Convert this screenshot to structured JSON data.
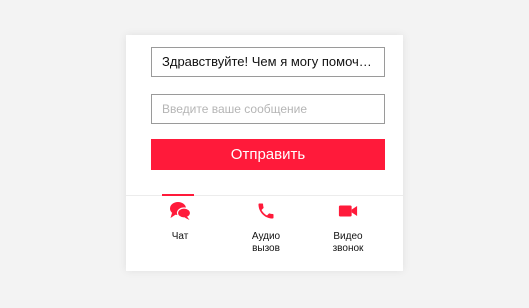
{
  "chat": {
    "greeting": "Здравствуйте! Чем я могу помочь вам?",
    "input_placeholder": "Введите ваше сообщение",
    "send_label": "Отправить"
  },
  "tabs": [
    {
      "label": "Чат",
      "icon": "chat-bubbles-icon"
    },
    {
      "label": "Аудио вызов",
      "icon": "phone-icon"
    },
    {
      "label": "Видео звонок",
      "icon": "video-camera-icon"
    }
  ],
  "colors": {
    "accent": "#ff1a3a",
    "border": "#9a9a9a",
    "placeholder": "#b5b5b5"
  }
}
